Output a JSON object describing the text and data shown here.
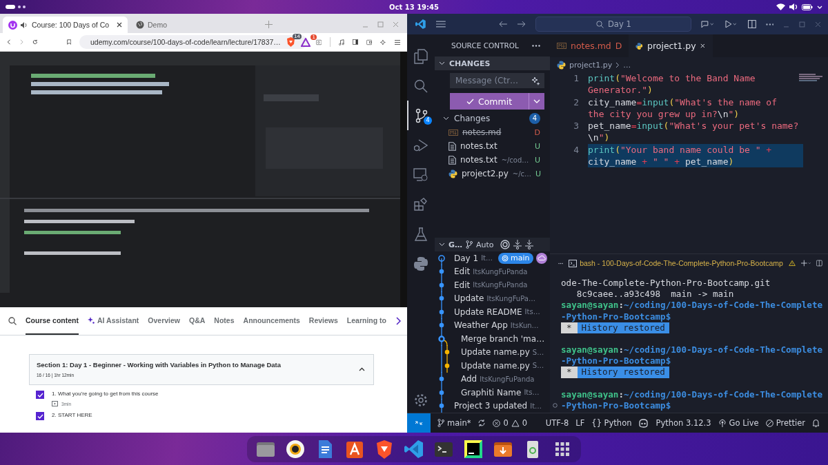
{
  "top_bar": {
    "datetime": "Oct 13  19:45"
  },
  "browser": {
    "tabs": [
      {
        "title": "Course: 100 Days of Co",
        "selected": true,
        "playing_audio": true
      },
      {
        "title": "Demo",
        "selected": false,
        "playing_audio": false
      }
    ],
    "url": "udemy.com/course/100-days-of-code/learn/lecture/17837…",
    "shield_badge": "14",
    "rewards_badge": "1",
    "course_tabs": [
      {
        "label": "Course content",
        "selected": true,
        "kind": "text"
      },
      {
        "label": "AI Assistant",
        "selected": false,
        "kind": "ai"
      },
      {
        "label": "Overview",
        "selected": false,
        "kind": "text"
      },
      {
        "label": "Q&A",
        "selected": false,
        "kind": "text"
      },
      {
        "label": "Notes",
        "selected": false,
        "kind": "text"
      },
      {
        "label": "Announcements",
        "selected": false,
        "kind": "text"
      },
      {
        "label": "Reviews",
        "selected": false,
        "kind": "text"
      },
      {
        "label": "Learning to",
        "selected": false,
        "kind": "text"
      }
    ],
    "section": {
      "title": "Section 1: Day 1 - Beginner - Working with Variables in Python to Manage Data",
      "meta": "16 / 16 | 1hr 12min",
      "expanded": true
    },
    "lectures": [
      {
        "title": "1. What you're going to get from this course",
        "duration": "3min",
        "checked": true
      },
      {
        "title": "2. START HERE",
        "checked": true
      }
    ]
  },
  "vscode": {
    "search": "Day 1",
    "activity": [
      {
        "kind": "files",
        "selected": false
      },
      {
        "kind": "search",
        "selected": false
      },
      {
        "kind": "scm",
        "selected": true,
        "badge": "4"
      },
      {
        "kind": "debug",
        "selected": false
      },
      {
        "kind": "remote",
        "selected": false
      },
      {
        "kind": "extensions",
        "selected": false
      },
      {
        "kind": "testing",
        "selected": false
      },
      {
        "kind": "python",
        "selected": false
      }
    ],
    "sidebar_title": "SOURCE CONTROL",
    "changes_header": "CHANGES",
    "message_placeholder": "Message (Ctr…",
    "commit_label": "Commit",
    "changes_group": {
      "label": "Changes",
      "count": "4",
      "expanded": true
    },
    "files": [
      {
        "name": "notes.md",
        "kind": "markdown",
        "status": "D",
        "deleted": true
      },
      {
        "name": "notes.txt",
        "kind": "text",
        "status": "U",
        "deleted": false
      },
      {
        "name": "notes.txt",
        "path": "~/cod…",
        "kind": "text",
        "status": "U",
        "deleted": false
      },
      {
        "name": "project2.py",
        "path": "~/c…",
        "kind": "python",
        "status": "U",
        "deleted": false
      }
    ],
    "graph": {
      "title": "G…",
      "mode": "Auto",
      "commits": [
        {
          "message": "Day 1",
          "author": "It…",
          "kind": "head",
          "color": "#3794ff",
          "indented": false,
          "branch": "main",
          "remote": true
        },
        {
          "message": "Edit",
          "author": "ItsKungFuPanda",
          "kind": "commit",
          "color": "#3794ff",
          "indented": false
        },
        {
          "message": "Edit",
          "author": "ItsKungFuPanda",
          "kind": "commit",
          "color": "#3794ff",
          "indented": false
        },
        {
          "message": "Update",
          "author": "ItsKungFuPa…",
          "kind": "commit",
          "color": "#3794ff",
          "indented": false
        },
        {
          "message": "Update README",
          "author": "Its…",
          "kind": "commit",
          "color": "#3794ff",
          "indented": false
        },
        {
          "message": "Weather App",
          "author": "ItsKun…",
          "kind": "commit",
          "color": "#3794ff",
          "indented": false
        },
        {
          "message": "Merge branch 'ma…",
          "kind": "merge",
          "color": "#3794ff",
          "indented": true
        },
        {
          "message": "Update name.py",
          "author": "S…",
          "kind": "side",
          "color": "#f5b400",
          "indented": true
        },
        {
          "message": "Update name.py",
          "author": "S…",
          "kind": "side",
          "color": "#f5b400",
          "indented": true
        },
        {
          "message": "Add",
          "author": "ItsKungFuPanda",
          "kind": "commit",
          "color": "#3794ff",
          "indented": true
        },
        {
          "message": "Graphiti Name",
          "author": "Its…",
          "kind": "commit",
          "color": "#3794ff",
          "indented": true
        },
        {
          "message": "Project 3 updated",
          "author": "It…",
          "kind": "commit",
          "color": "#3794ff",
          "indented": false
        }
      ]
    },
    "editor_tabs": [
      {
        "name": "notes.md",
        "status": "D",
        "kind": "markdown",
        "selected": false
      },
      {
        "name": "project1.py",
        "kind": "python",
        "selected": true
      }
    ],
    "breadcrumb": [
      "project1.py",
      "…"
    ],
    "code": [
      {
        "number": "1",
        "selected": false,
        "tokens": [
          {
            "kind": "fn",
            "text": "print"
          },
          {
            "kind": "paren",
            "text": "("
          },
          {
            "kind": "str",
            "text": "\"Welcome to the Band Name"
          },
          {
            "kind": "str",
            "text": "Generator.\"",
            "wrap_before": true
          },
          {
            "kind": "paren",
            "text": ")"
          }
        ]
      },
      {
        "number": "2",
        "selected": false,
        "tokens": [
          {
            "kind": "id",
            "text": "city_name"
          },
          {
            "kind": "op",
            "text": "="
          },
          {
            "kind": "fn",
            "text": "input"
          },
          {
            "kind": "paren",
            "text": "("
          },
          {
            "kind": "str",
            "text": "\"What's the name of"
          },
          {
            "kind": "str",
            "text": "the city you grew up in?",
            "wrap_before": true
          },
          {
            "kind": "id",
            "text": "\\n"
          },
          {
            "kind": "str",
            "text": "\""
          },
          {
            "kind": "paren",
            "text": ")"
          }
        ]
      },
      {
        "number": "3",
        "selected": false,
        "tokens": [
          {
            "kind": "id",
            "text": "pet_name"
          },
          {
            "kind": "op",
            "text": "="
          },
          {
            "kind": "fn",
            "text": "input"
          },
          {
            "kind": "paren",
            "text": "("
          },
          {
            "kind": "str",
            "text": "\"What's your pet's name?"
          },
          {
            "kind": "id",
            "text": "\\n",
            "wrap_before": true
          },
          {
            "kind": "str",
            "text": "\""
          },
          {
            "kind": "paren",
            "text": ")"
          }
        ]
      },
      {
        "number": "4",
        "selected": true,
        "tokens": [
          {
            "kind": "fn",
            "text": "print"
          },
          {
            "kind": "paren",
            "text": "("
          },
          {
            "kind": "str",
            "text": "\"Your band name could be \""
          },
          {
            "kind": "op",
            "text": " +"
          },
          {
            "kind": "id",
            "text": "city_name ",
            "wrap_before": true
          },
          {
            "kind": "op",
            "text": "+"
          },
          {
            "kind": "str",
            "text": " \" \" "
          },
          {
            "kind": "op",
            "text": "+"
          },
          {
            "kind": "id",
            "text": " pet_name"
          },
          {
            "kind": "paren",
            "text": ")"
          }
        ]
      }
    ],
    "terminal": {
      "title": "bash - 100-Days-of-Code-The-Complete-Python-Pro-Bootcamp",
      "lines": [
        {
          "kind": "text",
          "text": "ode-The-Complete-Python-Pro-Bootcamp.git"
        },
        {
          "kind": "text",
          "text": "   8c9caee..a93c498  main -> main"
        },
        {
          "kind": "prompt",
          "user": "sayan@sayan",
          "sep": ":",
          "path": "~/coding/100-Days-of-Code-The-Complete",
          "path_cont": "-Python-Pro-Bootcamp$",
          "marker": false
        },
        {
          "kind": "restored",
          "mark": "*",
          "text": "History restored"
        },
        {
          "kind": "prompt",
          "user": "sayan@sayan",
          "sep": ":",
          "path": "~/coding/100-Days-of-Code-The-Complete",
          "path_cont": "-Python-Pro-Bootcamp$",
          "marker": false
        },
        {
          "kind": "restored",
          "mark": "*",
          "text": "History restored"
        },
        {
          "kind": "prompt",
          "user": "sayan@sayan",
          "sep": ":",
          "path": "~/coding/100-Days-of-Code-The-Complete",
          "path_cont": "-Python-Pro-Bootcamp$",
          "marker": true
        }
      ]
    },
    "status_bar": {
      "branch": "main*",
      "errors": "0",
      "warnings": "0",
      "items": [
        {
          "kind": "text",
          "label": "UTF-8"
        },
        {
          "kind": "text",
          "label": "LF"
        },
        {
          "kind": "text",
          "label": "{} Python"
        },
        {
          "kind": "copilot"
        },
        {
          "kind": "text",
          "label": "Python 3.12.3"
        },
        {
          "kind": "live",
          "label": "Go Live"
        },
        {
          "kind": "prettier",
          "label": "Prettier"
        },
        {
          "kind": "bell"
        }
      ]
    }
  }
}
